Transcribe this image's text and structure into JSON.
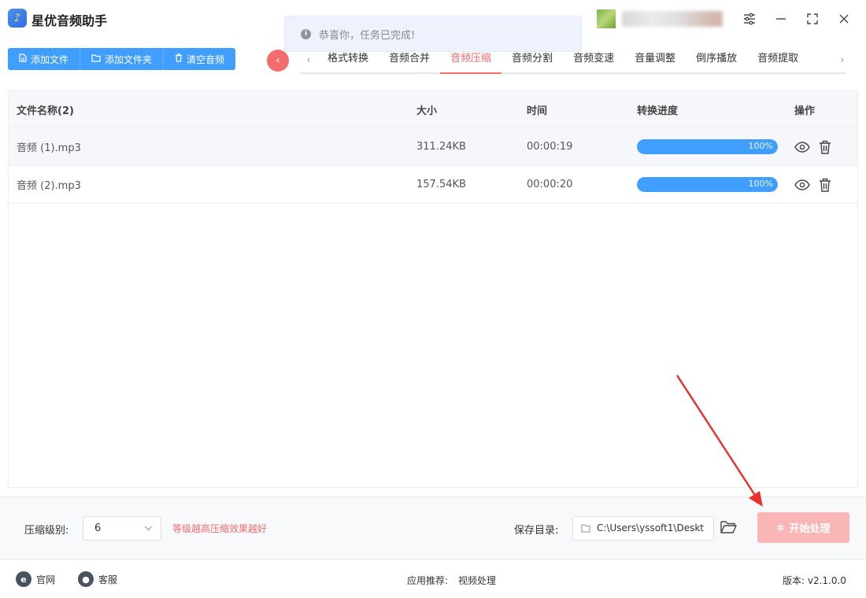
{
  "app": {
    "title": "星优音频助手"
  },
  "toast": {
    "message": "恭喜你，任务已完成!"
  },
  "toolbar": {
    "add_file": "添加文件",
    "add_folder": "添加文件夹",
    "clear_audio": "清空音频"
  },
  "tabs": [
    {
      "label": "格式转换"
    },
    {
      "label": "音频合并"
    },
    {
      "label": "音频压缩",
      "active": true
    },
    {
      "label": "音频分割"
    },
    {
      "label": "音频变速"
    },
    {
      "label": "音量调整"
    },
    {
      "label": "倒序播放"
    },
    {
      "label": "音频提取"
    }
  ],
  "table": {
    "headers": {
      "name": "文件名称(2)",
      "size": "大小",
      "time": "时间",
      "progress": "转换进度",
      "ops": "操作"
    },
    "rows": [
      {
        "name": "音频 (1).mp3",
        "size": "311.24KB",
        "time": "00:00:19",
        "progress": 1.0,
        "progress_label": "100%"
      },
      {
        "name": "音频 (2).mp3",
        "size": "157.54KB",
        "time": "00:00:20",
        "progress": 1.0,
        "progress_label": "100%"
      }
    ]
  },
  "settings": {
    "level_label": "压缩级别:",
    "level_value": "6",
    "hint": "等级越高压缩效果越好",
    "save_label": "保存目录:",
    "save_path": "C:\\Users\\yssoft1\\Deskt",
    "start_label": "开始处理"
  },
  "footer": {
    "website": "官网",
    "support": "客服",
    "recommend_label": "应用推荐:",
    "recommend_value": "视频处理",
    "version": "版本: v2.1.0.0"
  },
  "colors": {
    "primary": "#409eff",
    "danger": "#f56c6c",
    "start_disabled": "#fab6b6"
  }
}
